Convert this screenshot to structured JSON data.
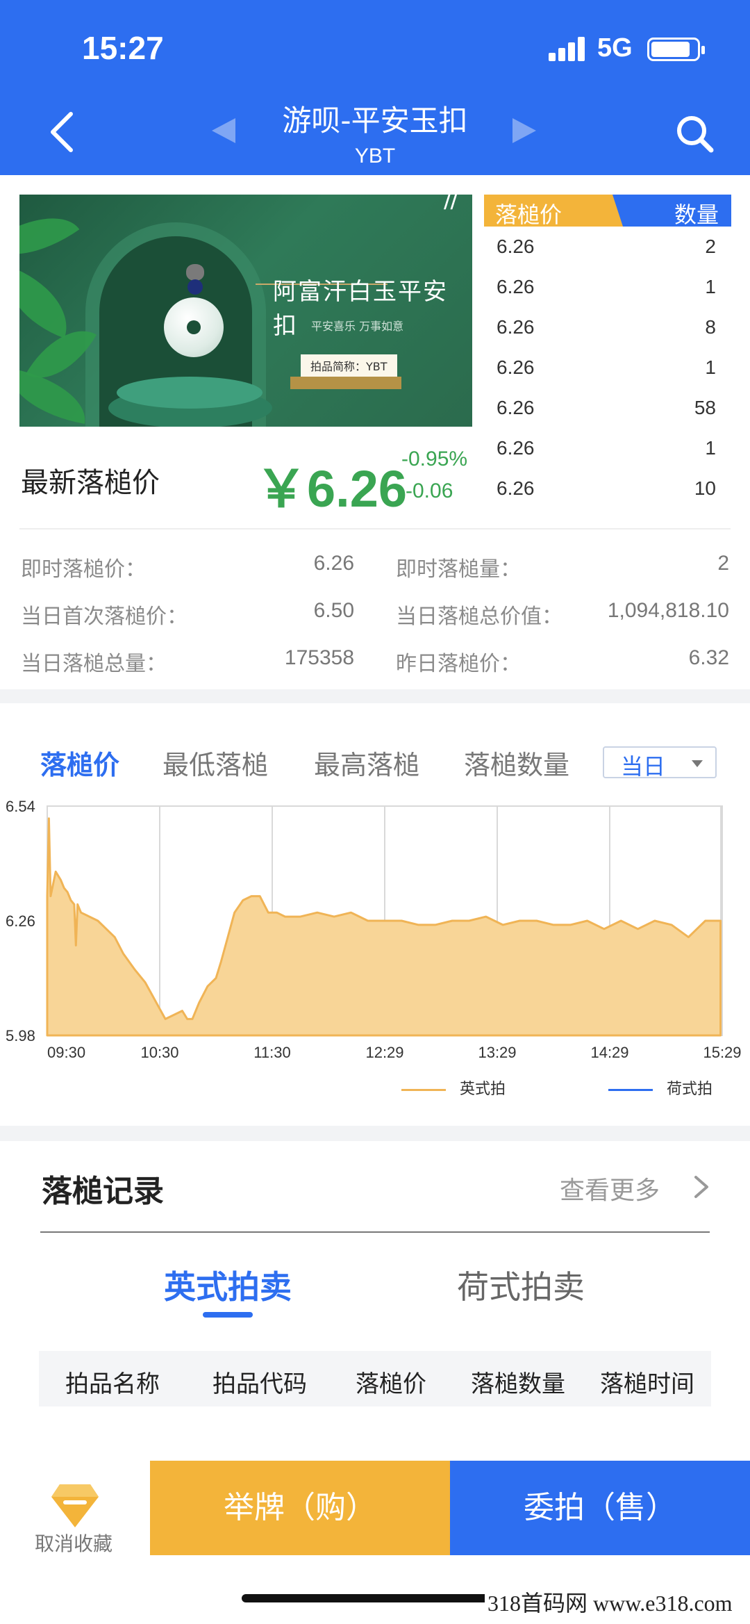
{
  "status_bar": {
    "time": "15:27",
    "network": "5G"
  },
  "nav": {
    "title": "游呗-平安玉扣",
    "subtitle": "YBT"
  },
  "banner": {
    "headline": "阿富汗白玉平安扣",
    "tagline": "平安喜乐 万事如意",
    "tag": "拍品简称：YBT"
  },
  "latest": {
    "label": "最新落槌价",
    "price": "￥6.26",
    "change_pct": "-0.95%",
    "change_abs": "-0.06"
  },
  "orderbook": {
    "price_header": "落槌价",
    "qty_header": "数量",
    "rows": [
      {
        "price": "6.26",
        "qty": "2"
      },
      {
        "price": "6.26",
        "qty": "1"
      },
      {
        "price": "6.26",
        "qty": "8"
      },
      {
        "price": "6.26",
        "qty": "1"
      },
      {
        "price": "6.26",
        "qty": "58"
      },
      {
        "price": "6.26",
        "qty": "1"
      },
      {
        "price": "6.26",
        "qty": "10"
      }
    ]
  },
  "stats": [
    {
      "label": "即时落槌价：",
      "value": "6.26"
    },
    {
      "label": "即时落槌量：",
      "value": "2"
    },
    {
      "label": "当日首次落槌价：",
      "value": "6.50"
    },
    {
      "label": "当日落槌总价值：",
      "value": "1,094,818.10"
    },
    {
      "label": "当日落槌总量：",
      "value": "175358"
    },
    {
      "label": "昨日落槌价：",
      "value": "6.32"
    }
  ],
  "chart_tabs": [
    "落槌价",
    "最低落槌",
    "最高落槌",
    "落槌数量"
  ],
  "period": "当日",
  "colors": {
    "primary": "#2d6ef0",
    "accent": "#f3b43a",
    "down": "#3aa552",
    "area_fill": "#f8d597",
    "area_line": "#f0b456"
  },
  "chart_data": {
    "type": "area",
    "title": "",
    "xlabel": "",
    "ylabel": "",
    "x_ticks": [
      "09:30",
      "10:30",
      "11:30",
      "12:29",
      "13:29",
      "14:29",
      "15:29"
    ],
    "y_ticks": [
      "5.98",
      "6.26",
      "6.54"
    ],
    "ylim": [
      5.98,
      6.54
    ],
    "grid": true,
    "legend_position": "bottom-right",
    "series": [
      {
        "name": "英式拍",
        "color": "#f0b456",
        "points": [
          [
            0,
            6.32
          ],
          [
            1,
            6.51
          ],
          [
            2,
            6.32
          ],
          [
            3,
            6.34
          ],
          [
            5,
            6.38
          ],
          [
            8,
            6.36
          ],
          [
            10,
            6.34
          ],
          [
            12,
            6.33
          ],
          [
            14,
            6.31
          ],
          [
            16,
            6.3
          ],
          [
            17,
            6.2
          ],
          [
            18,
            6.3
          ],
          [
            20,
            6.28
          ],
          [
            25,
            6.27
          ],
          [
            30,
            6.26
          ],
          [
            35,
            6.24
          ],
          [
            40,
            6.22
          ],
          [
            45,
            6.18
          ],
          [
            52,
            6.14
          ],
          [
            58,
            6.11
          ],
          [
            62,
            6.08
          ],
          [
            66,
            6.05
          ],
          [
            70,
            6.02
          ],
          [
            75,
            6.03
          ],
          [
            80,
            6.04
          ],
          [
            83,
            6.02
          ],
          [
            86,
            6.02
          ],
          [
            90,
            6.06
          ],
          [
            95,
            6.1
          ],
          [
            100,
            6.12
          ],
          [
            103,
            6.16
          ],
          [
            107,
            6.22
          ],
          [
            111,
            6.28
          ],
          [
            116,
            6.31
          ],
          [
            121,
            6.32
          ],
          [
            126,
            6.32
          ],
          [
            131,
            6.28
          ],
          [
            136,
            6.28
          ],
          [
            141,
            6.27
          ],
          [
            150,
            6.27
          ],
          [
            160,
            6.28
          ],
          [
            170,
            6.27
          ],
          [
            180,
            6.28
          ],
          [
            190,
            6.26
          ],
          [
            200,
            6.26
          ],
          [
            210,
            6.26
          ],
          [
            220,
            6.25
          ],
          [
            230,
            6.25
          ],
          [
            240,
            6.26
          ],
          [
            250,
            6.26
          ],
          [
            260,
            6.27
          ],
          [
            270,
            6.25
          ],
          [
            280,
            6.26
          ],
          [
            290,
            6.26
          ],
          [
            300,
            6.25
          ],
          [
            310,
            6.25
          ],
          [
            320,
            6.26
          ],
          [
            330,
            6.24
          ],
          [
            340,
            6.26
          ],
          [
            350,
            6.24
          ],
          [
            360,
            6.26
          ],
          [
            370,
            6.25
          ],
          [
            380,
            6.22
          ],
          [
            390,
            6.26
          ],
          [
            395,
            6.26
          ],
          [
            399,
            6.26
          ]
        ]
      },
      {
        "name": "荷式拍",
        "color": "#2d6ef0",
        "points": []
      }
    ]
  },
  "records": {
    "title": "落槌记录",
    "more": "查看更多",
    "tabs": [
      "英式拍卖",
      "荷式拍卖"
    ],
    "columns": [
      "拍品名称",
      "拍品代码",
      "落槌价",
      "落槌数量",
      "落槌时间"
    ]
  },
  "bottom": {
    "fav_label": "取消收藏",
    "buy_label": "举牌（购）",
    "sell_label": "委拍（售）"
  },
  "watermark": "318首码网 www.e318.com"
}
